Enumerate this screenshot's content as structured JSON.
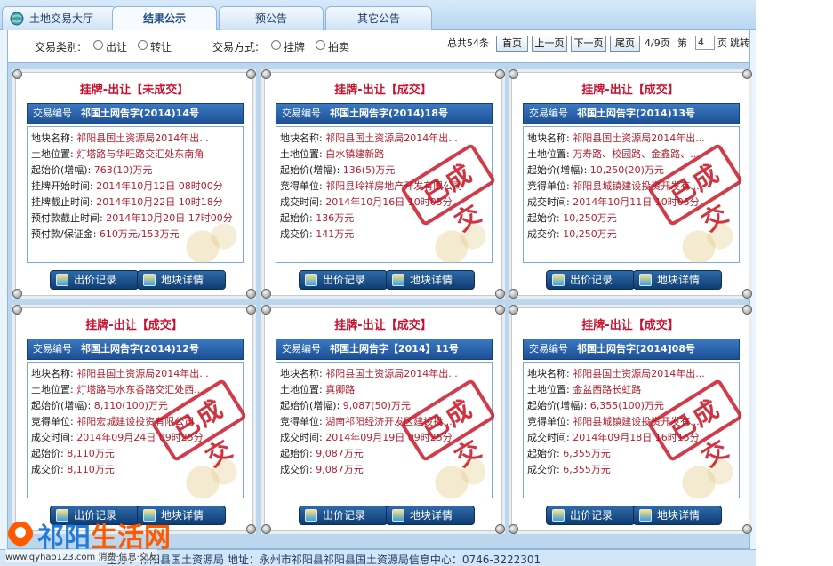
{
  "tabs": [
    {
      "label": "土地交易大厅"
    },
    {
      "label": "结果公示"
    },
    {
      "label": "预公告"
    },
    {
      "label": "其它公告"
    }
  ],
  "filters": {
    "type_label": "交易类别:",
    "type_options": [
      "出让",
      "转让"
    ],
    "method_label": "交易方式:",
    "method_options": [
      "挂牌",
      "拍卖"
    ]
  },
  "pager": {
    "total": "总共54条",
    "first": "首页",
    "prev": "上一页",
    "next": "下一页",
    "last": "尾页",
    "page_info": "4/9页",
    "goto_prefix": "第",
    "goto_value": "4",
    "goto_suffix": "页",
    "jump": "跳转"
  },
  "buttons": {
    "bid": "出价记录",
    "detail": "地块详情"
  },
  "stamp_text": "已成交",
  "cards": [
    {
      "title": "挂牌-出让【未成交】",
      "code_label": "交易编号",
      "code": "祁国土网告字(2014)14号",
      "rows": [
        {
          "label": "地块名称:",
          "value": "祁阳县国土资源局2014年出..."
        },
        {
          "label": "土地位置:",
          "value": "灯塔路与华旺路交汇处东南角"
        },
        {
          "label": "起始价(增幅):",
          "value": "763(10)万元"
        },
        {
          "label": "挂牌开始时间:",
          "value": "2014年10月12日 08时00分"
        },
        {
          "label": "挂牌截止时间:",
          "value": "2014年10月22日 10时18分"
        },
        {
          "label": "预付款截止时间:",
          "value": "2014年10月20日 17时00分"
        },
        {
          "label": "预付款/保证金:",
          "value": "610万元/153万元"
        }
      ],
      "stamped": false
    },
    {
      "title": "挂牌-出让【成交】",
      "code_label": "交易编号",
      "code": "祁国土网告字(2014)18号",
      "rows": [
        {
          "label": "地块名称:",
          "value": "祁阳县国土资源局2014年出..."
        },
        {
          "label": "土地位置:",
          "value": "白水镇建新路"
        },
        {
          "label": "起始价(增幅):",
          "value": "136(5)万元"
        },
        {
          "label": "竞得单位:",
          "value": "祁阳县玲祥房地产开发有限公司"
        },
        {
          "label": "成交时间:",
          "value": "2014年10月16日 10时05分"
        },
        {
          "label": "起始价:",
          "value": "136万元"
        },
        {
          "label": "成交价:",
          "value": "141万元"
        }
      ],
      "stamped": true
    },
    {
      "title": "挂牌-出让【成交】",
      "code_label": "交易编号",
      "code": "祁国土网告字(2014)13号",
      "rows": [
        {
          "label": "地块名称:",
          "value": "祁阳县国土资源局2014年出..."
        },
        {
          "label": "土地位置:",
          "value": "万寿路、校园路、金鑫路、..."
        },
        {
          "label": "起始价(增幅):",
          "value": "10,250(20)万元"
        },
        {
          "label": "竞得单位:",
          "value": "祁阳县城镇建设投资开发有..."
        },
        {
          "label": "成交时间:",
          "value": "2014年10月11日 10时05分"
        },
        {
          "label": "起始价:",
          "value": "10,250万元"
        },
        {
          "label": "成交价:",
          "value": "10,250万元"
        }
      ],
      "stamped": true
    },
    {
      "title": "挂牌-出让【成交】",
      "code_label": "交易编号",
      "code": "祁国土网告字(2014)12号",
      "rows": [
        {
          "label": "地块名称:",
          "value": "祁阳县国土资源局2014年出..."
        },
        {
          "label": "土地位置:",
          "value": "灯塔路与水东香路交汇处西..."
        },
        {
          "label": "起始价(增幅):",
          "value": "8,110(100)万元"
        },
        {
          "label": "竞得单位:",
          "value": "祁阳宏城建设投资有限公司"
        },
        {
          "label": "成交时间:",
          "value": "2014年09月24日 09时25分"
        },
        {
          "label": "起始价:",
          "value": "8,110万元"
        },
        {
          "label": "成交价:",
          "value": "8,110万元"
        }
      ],
      "stamped": true
    },
    {
      "title": "挂牌-出让【成交】",
      "code_label": "交易编号",
      "code": "祁国土网告字【2014】11号",
      "rows": [
        {
          "label": "地块名称:",
          "value": "祁阳县国土资源局2014年出..."
        },
        {
          "label": "土地位置:",
          "value": "真卿路"
        },
        {
          "label": "起始价(增幅):",
          "value": "9,087(50)万元"
        },
        {
          "label": "竞得单位:",
          "value": "湖南祁阳经济开发区建设投..."
        },
        {
          "label": "成交时间:",
          "value": "2014年09月19日 09时25分"
        },
        {
          "label": "起始价:",
          "value": "9,087万元"
        },
        {
          "label": "成交价:",
          "value": "9,087万元"
        }
      ],
      "stamped": true
    },
    {
      "title": "挂牌-出让【成交】",
      "code_label": "交易编号",
      "code": "祁国土网告字[2014]08号",
      "rows": [
        {
          "label": "地块名称:",
          "value": "祁阳县国土资源局2014年出..."
        },
        {
          "label": "土地位置:",
          "value": "金盆西路长虹路"
        },
        {
          "label": "起始价(增幅):",
          "value": "6,355(100)万元"
        },
        {
          "label": "竞得单位:",
          "value": "祁阳县城镇建设投资开发有..."
        },
        {
          "label": "成交时间:",
          "value": "2014年09月18日 16时15分"
        },
        {
          "label": "起始价:",
          "value": "6,355万元"
        },
        {
          "label": "成交价:",
          "value": "6,355万元"
        }
      ],
      "stamped": true
    }
  ],
  "footer": {
    "text": "主办：祁阳县国土资源局    地址：永州市祁阳县祁阳县国土资源局信息中心：0746-3222301"
  },
  "watermark": {
    "part1": "祁阳",
    "part2": "生活网",
    "url": "www.qyhao123.com 消费·信息·交友"
  }
}
